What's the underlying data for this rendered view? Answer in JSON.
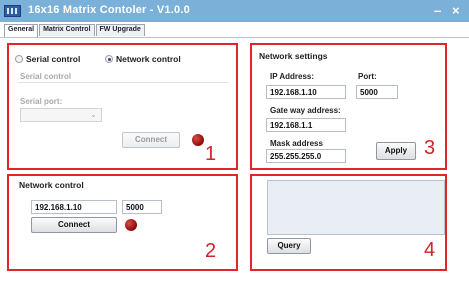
{
  "window": {
    "title": "16x16 Matrix Contoler - V1.0.0",
    "minimize_glyph": "–",
    "close_glyph": "×"
  },
  "tabs": [
    {
      "label": "General",
      "active": true
    },
    {
      "label": "Matrix Control",
      "active": false
    },
    {
      "label": "FW Upgrade",
      "active": false
    }
  ],
  "panel1": {
    "radio_serial": "Serial control",
    "radio_network": "Network control",
    "selected": "Network control",
    "group_label": "Serial control",
    "serial_port_label": "Serial port:",
    "serial_port_value": "",
    "connect_label": "Connect",
    "number": "1"
  },
  "panel2": {
    "title": "Network control",
    "ip": "192.168.1.10",
    "port": "5000",
    "connect_label": "Connect",
    "number": "2"
  },
  "panel3": {
    "title": "Network settings",
    "ip_label": "IP Address:",
    "ip_value": "192.168.1.10",
    "port_label": "Port:",
    "port_value": "5000",
    "gateway_label": "Gate way address:",
    "gateway_value": "192.168.1.1",
    "mask_label": "Mask address",
    "mask_value": "255.255.255.0",
    "apply_label": "Apply",
    "number": "3"
  },
  "panel4": {
    "query_label": "Query",
    "number": "4"
  },
  "colors": {
    "titlebar": "#7bb0d9",
    "panel_border": "#e1262b",
    "status_led": "#a01010"
  },
  "icons": {
    "app": "matrix-grid-icon"
  }
}
